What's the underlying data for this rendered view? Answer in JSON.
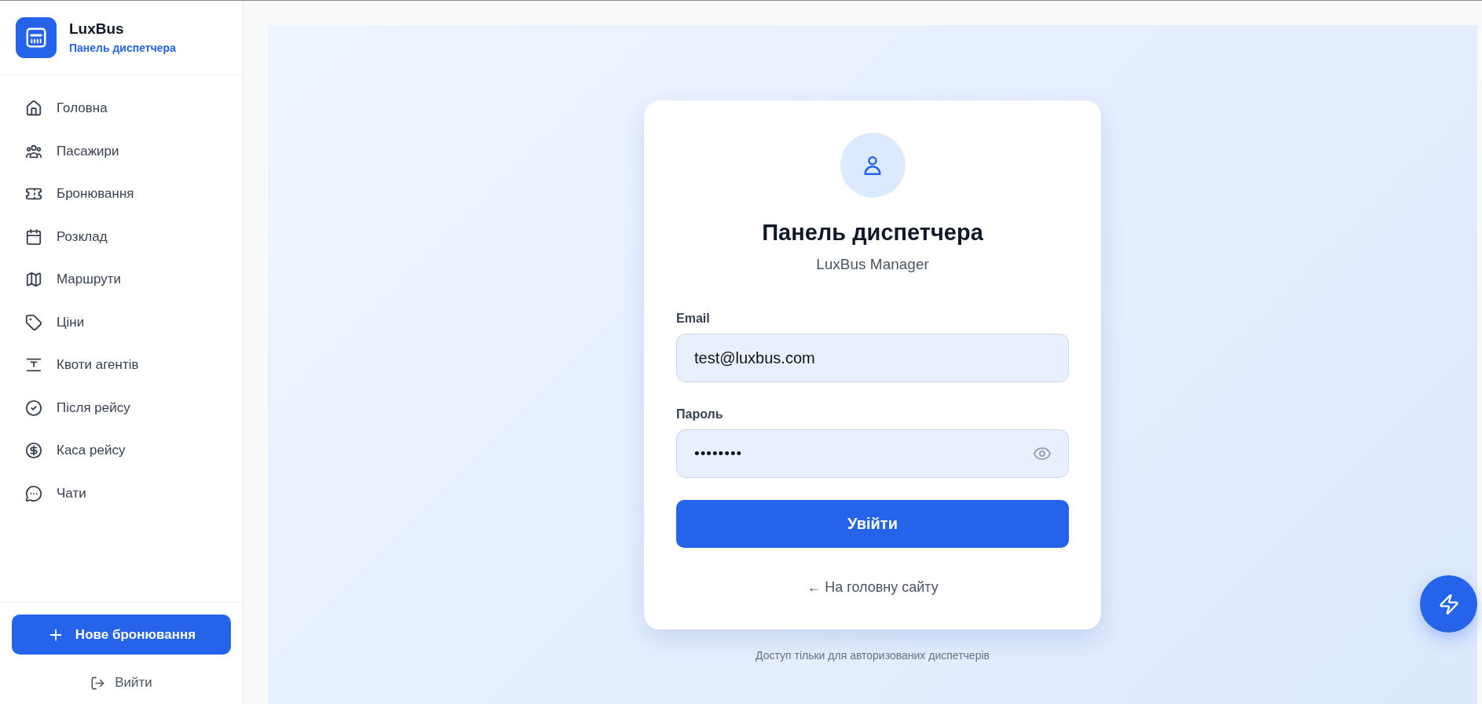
{
  "sidebar": {
    "brand": {
      "name": "LuxBus",
      "subtitle": "Панель диспетчера"
    },
    "items": [
      {
        "label": "Головна",
        "selected": false
      },
      {
        "label": "Пасажири",
        "selected": false
      },
      {
        "label": "Бронювання",
        "selected": false
      },
      {
        "label": "Розклад",
        "selected": false
      },
      {
        "label": "Маршрути",
        "selected": false
      },
      {
        "label": "Ціни",
        "selected": false
      },
      {
        "label": "Квоти агентів",
        "selected": false
      },
      {
        "label": "Після рейсу",
        "selected": false
      },
      {
        "label": "Каса рейсу",
        "selected": false
      },
      {
        "label": "Чати",
        "selected": false
      }
    ],
    "new_booking_button": "Нове бронювання",
    "logout_button": "Вийти"
  },
  "login_card": {
    "title": "Панель диспетчера",
    "subtitle": "LuxBus Manager",
    "fields": [
      {
        "kind": "email",
        "label": "Email",
        "value": "test@luxbus.com"
      },
      {
        "kind": "password",
        "label": "Пароль",
        "value": "••••••••"
      }
    ],
    "submit_button": "Увійти",
    "back_link": "← На головну сайту"
  },
  "access_note": "Доступ тільки для авторизованих диспетчерів"
}
